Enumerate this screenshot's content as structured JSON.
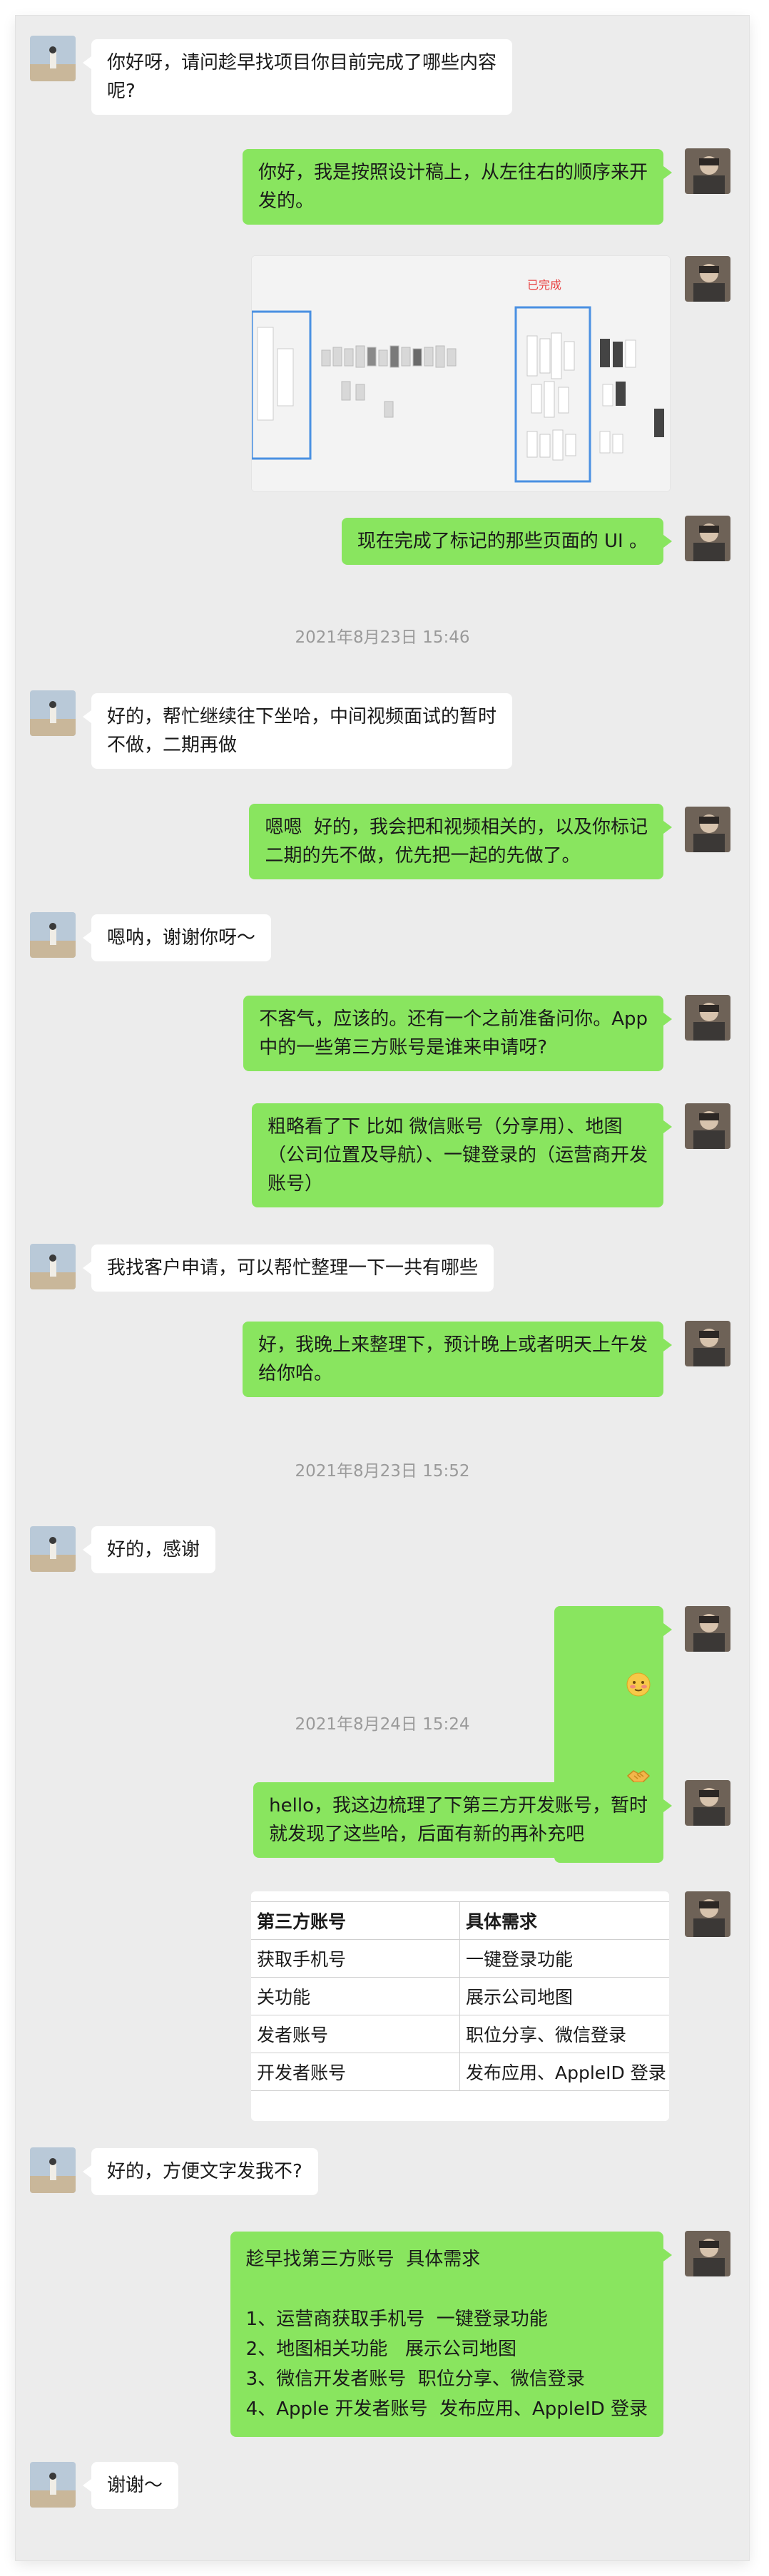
{
  "messages": [
    {
      "side": "left",
      "text": "你好呀，请问趁早找项目你目前完成了哪些内容\n呢?"
    },
    {
      "side": "right",
      "text": "你好，我是按照设计稿上，从左往右的顺序来开\n发的。"
    },
    {
      "side": "right",
      "type": "image",
      "caption": "已完成"
    },
    {
      "side": "right",
      "text": "现在完成了标记的那些页面的 UI 。"
    },
    {
      "type": "timestamp",
      "text": "2021年8月23日 15:46"
    },
    {
      "side": "left",
      "text": "好的，帮忙继续往下坐哈，中间视频面试的暂时\n不做，二期再做"
    },
    {
      "side": "right",
      "text": "嗯嗯  好的，我会把和视频相关的，以及你标记\n二期的先不做，优先把一起的先做了。"
    },
    {
      "side": "left",
      "text": "嗯呐，谢谢你呀～"
    },
    {
      "side": "right",
      "text": "不客气，应该的。还有一个之前准备问你。App\n中的一些第三方账号是谁来申请呀?"
    },
    {
      "side": "right",
      "text": "粗略看了下 比如 微信账号（分享用）、地图\n（公司位置及导航）、一键登录的（运营商开发\n账号）"
    },
    {
      "side": "left",
      "text": "我找客户申请，可以帮忙整理一下一共有哪些"
    },
    {
      "side": "right",
      "text": "好，我晚上来整理下，预计晚上或者明天上午发\n给你哈。"
    },
    {
      "type": "timestamp",
      "text": "2021年8月23日 15:52"
    },
    {
      "side": "left",
      "text": "好的，感谢"
    },
    {
      "side": "right",
      "type": "emoji",
      "icons": [
        "blush-emoji",
        "handshake-emoji"
      ]
    },
    {
      "type": "timestamp",
      "text": "2021年8月24日 15:24"
    },
    {
      "side": "right",
      "text": "hello，我这边梳理了下第三方开发账号，暂时\n就发现了这些哈，后面有新的再补充吧"
    },
    {
      "side": "right",
      "type": "table",
      "headers": [
        "第三方账号",
        "具体需求"
      ],
      "rows": [
        [
          "获取手机号",
          "一键登录功能"
        ],
        [
          "关功能",
          "展示公司地图"
        ],
        [
          "发者账号",
          "职位分享、微信登录"
        ],
        [
          "开发者账号",
          "发布应用、AppleID 登录"
        ]
      ]
    },
    {
      "side": "left",
      "text": "好的，方便文字发我不?"
    },
    {
      "side": "right",
      "text": "趁早找第三方账号  具体需求\n\n1、运营商获取手机号  一键登录功能\n2、地图相关功能   展示公司地图\n3、微信开发者账号  职位分享、微信登录\n4、Apple 开发者账号  发布应用、AppleID 登录"
    },
    {
      "side": "left",
      "text": "谢谢～"
    }
  ],
  "colors": {
    "chat_bg": "#ececec",
    "bubble_self": "#89e55f",
    "bubble_other": "#ffffff",
    "timestamp": "#9a9a9a",
    "highlight": "#4a90e2",
    "done_label": "#e84545"
  }
}
